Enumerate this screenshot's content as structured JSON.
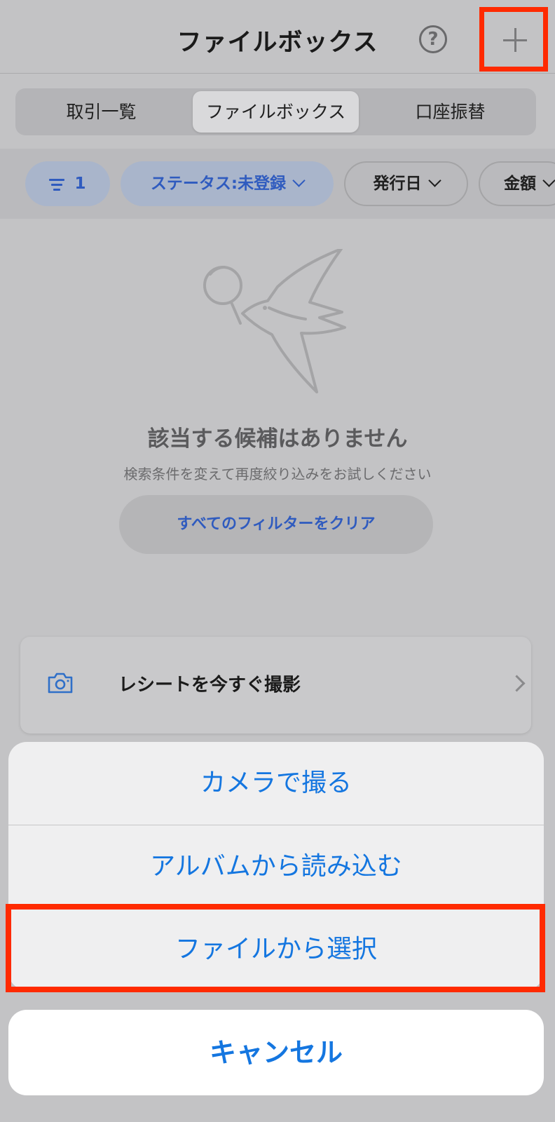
{
  "header": {
    "title": "ファイルボックス",
    "help_symbol": "?",
    "add_icon": "plus-icon",
    "help_icon": "question-circle-icon"
  },
  "tabs": [
    {
      "label": "取引一覧",
      "active": false
    },
    {
      "label": "ファイルボックス",
      "active": true
    },
    {
      "label": "口座振替",
      "active": false
    }
  ],
  "filters": {
    "count": "1",
    "status": "ステータス:未登録",
    "issue_date": "発行日",
    "amount": "金額"
  },
  "empty_state": {
    "title": "該当する候補はありません",
    "subtitle": "検索条件を変えて再度絞り込みをお試しください",
    "clear_button": "すべてのフィルターをクリア"
  },
  "receipt_card": {
    "label": "レシートを今すぐ撮影",
    "icon": "camera-icon"
  },
  "action_sheet": {
    "items": [
      "カメラで撮る",
      "アルバムから読み込む",
      "ファイルから選択"
    ],
    "cancel": "キャンセル"
  },
  "colors": {
    "accent_blue": "#1476e0",
    "filter_blue": "#2f5bbf",
    "highlight_red": "#ff2a00"
  }
}
